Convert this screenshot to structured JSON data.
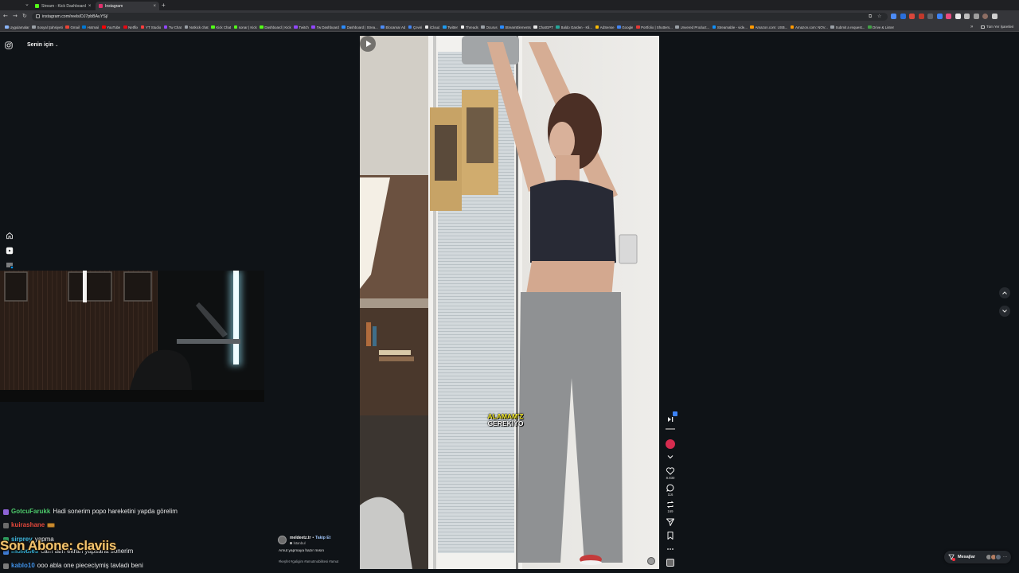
{
  "browser": {
    "tab_search_label": "⌄",
    "tabs": [
      {
        "title": "Stream - Kick Dashboard",
        "icon": "kick-icon",
        "color": "#53fc18"
      },
      {
        "title": "Instagram",
        "icon": "instagram-icon",
        "color": "#e1306c"
      }
    ],
    "tab_close_label": "×",
    "new_tab_label": "+",
    "back_label": "←",
    "forward_label": "→",
    "reload_label": "↻",
    "url": "instagram.com/reels/DJ7pbBAuYSj/",
    "install_label": "⧉",
    "star_label": "☆",
    "extensions": [
      {
        "icon": "extension-blue-icon",
        "color": "#4c8bf5"
      },
      {
        "icon": "extension-blue-icon",
        "color": "#2a6fdb"
      },
      {
        "icon": "extension-red-icon",
        "color": "#d9473b"
      },
      {
        "icon": "extension-red-icon",
        "color": "#c0392b"
      },
      {
        "icon": "extension-gray-icon",
        "color": "#5f6368"
      },
      {
        "icon": "extension-blue-icon",
        "color": "#3b82f6"
      },
      {
        "icon": "extension-pink-icon",
        "color": "#e84a7f"
      },
      {
        "icon": "extension-white-icon",
        "color": "#e8e8e8"
      },
      {
        "icon": "puzzle-icon",
        "color": "#bdbdbd"
      },
      {
        "icon": "sidebar-icon",
        "color": "#9e9e9e"
      },
      {
        "icon": "profile-avatar-icon",
        "color": "#8d6e63"
      },
      {
        "icon": "kebab-menu-icon",
        "color": "#cfcfcf"
      }
    ],
    "bookmarks": [
      {
        "label": "Uygulamalar",
        "icon": "apps-grid-icon",
        "color": "#8ab4f8"
      },
      {
        "label": "Sosyal Şahsiyeti",
        "icon": "folder-icon",
        "color": "#9aa0a6"
      },
      {
        "label": "Gmail",
        "icon": "gmail-icon",
        "color": "#ea4335"
      },
      {
        "label": "Hotmail",
        "icon": "outlook-icon",
        "color": "#0078d4"
      },
      {
        "label": "YouTube",
        "icon": "youtube-icon",
        "color": "#ff0000"
      },
      {
        "label": "Netflix",
        "icon": "netflix-icon",
        "color": "#e50914"
      },
      {
        "label": "YT Studio",
        "icon": "youtube-studio-icon",
        "color": "#ff3d3d"
      },
      {
        "label": "Tw Chat",
        "icon": "twitch-icon",
        "color": "#9146ff"
      },
      {
        "label": "Notkick chat",
        "icon": "globe-icon",
        "color": "#9aa0a6"
      },
      {
        "label": "Kick Chat",
        "icon": "kick-icon",
        "color": "#53fc18"
      },
      {
        "label": "sonar | Kick",
        "icon": "kick-icon",
        "color": "#53fc18"
      },
      {
        "label": "Dashboard | Kick",
        "icon": "kick-icon",
        "color": "#53fc18"
      },
      {
        "label": "Twitch",
        "icon": "twitch-icon",
        "color": "#9146ff"
      },
      {
        "label": "Tw Dashboard",
        "icon": "twitch-icon",
        "color": "#9146ff"
      },
      {
        "label": "Dashboard | Strea...",
        "icon": "streamelements-icon",
        "color": "#2a8cff"
      },
      {
        "label": "Elocamar Ad",
        "icon": "globe-icon",
        "color": "#4c8bf5"
      },
      {
        "label": "Çeviri",
        "icon": "translate-icon",
        "color": "#4285f4"
      },
      {
        "label": "iCloud",
        "icon": "apple-icon",
        "color": "#e8e8e8"
      },
      {
        "label": "Twitter",
        "icon": "twitter-icon",
        "color": "#1d9bf0"
      },
      {
        "label": "Threads",
        "icon": "threads-icon",
        "color": "#f1f1f1"
      },
      {
        "label": "Ocurus",
        "icon": "globe-icon",
        "color": "#9aa0a6"
      },
      {
        "label": "StreamElements",
        "icon": "streamelements-icon",
        "color": "#2a8cff"
      },
      {
        "label": "ChatGPT",
        "icon": "chatgpt-icon",
        "color": "#e8e8e8"
      },
      {
        "label": "Baldo Garden - Kli...",
        "icon": "globe-icon",
        "color": "#26a69a"
      },
      {
        "label": "AdSense",
        "icon": "adsense-icon",
        "color": "#fbbc04"
      },
      {
        "label": "Google",
        "icon": "google-icon",
        "color": "#4285f4"
      },
      {
        "label": "Portfolio | Shutters...",
        "icon": "shutterstock-icon",
        "color": "#e53935"
      },
      {
        "label": "Unvered Product...",
        "icon": "globe-icon",
        "color": "#9aa0a6"
      },
      {
        "label": "Streamable - vide...",
        "icon": "streamable-icon",
        "color": "#0f90fa"
      },
      {
        "label": "Amazon.com: USB...",
        "icon": "amazon-icon",
        "color": "#ff9900"
      },
      {
        "label": "Amazon.com: NOV...",
        "icon": "amazon-icon",
        "color": "#ff9900"
      },
      {
        "label": "Submit a request...",
        "icon": "globe-icon",
        "color": "#9aa0a6"
      },
      {
        "label": "Drive & Listen",
        "icon": "globe-icon",
        "color": "#43a047"
      }
    ],
    "bookmarks_overflow": "»",
    "all_bookmarks_label": "Tüm Yer İşaretleri"
  },
  "instagram": {
    "logo": "instagram-icon",
    "feed_selector_label": "Senin için",
    "feed_selector_chevron": "⌄",
    "nav": [
      "home-icon",
      "reels-icon",
      "menu-icon"
    ],
    "accent_color": "#0095f6",
    "reel": {
      "subtitle_line1": "ALAMAM'Z",
      "subtitle_line2": "GEREKİYO",
      "author": "meldeetz.tr",
      "separator": "•",
      "follow_label": "Takip Et",
      "location": "İstanbul",
      "caption": "Amut yapmaya hazır mısın",
      "hashtags": "#keşfet #galigim #amutmobilitesi #amut",
      "likes": "8.830",
      "comments": "116",
      "reposts": "169"
    },
    "messages_label": "Mesajlar"
  },
  "stream_overlay": {
    "last_subscriber": "Son Abone: claviis",
    "chat": [
      {
        "user": "GotcuFarukk",
        "color": "#4cc86a",
        "message": "Hadi sonerim popo hareketini yapda görelim",
        "badge_color": "#8e63d6"
      },
      {
        "user": "kuirashane",
        "color": "#e2473b",
        "emote": "emote-icon",
        "badge_color": "#6b6b6b"
      },
      {
        "user": "sirprey",
        "color": "#3fb9e0",
        "message": "yapma",
        "badge_color": "#2e9c5e"
      },
      {
        "user": "muwdies",
        "color": "#36b3d8",
        "message": "cam tam ekran yapsana sonerim",
        "badge_color": "#3f7dd6"
      },
      {
        "user": "kablo10",
        "color": "#3f8fe4",
        "message": "ooo abla one piececiymiş tavladı beni",
        "badge_color": "#7a7a7a"
      }
    ]
  }
}
